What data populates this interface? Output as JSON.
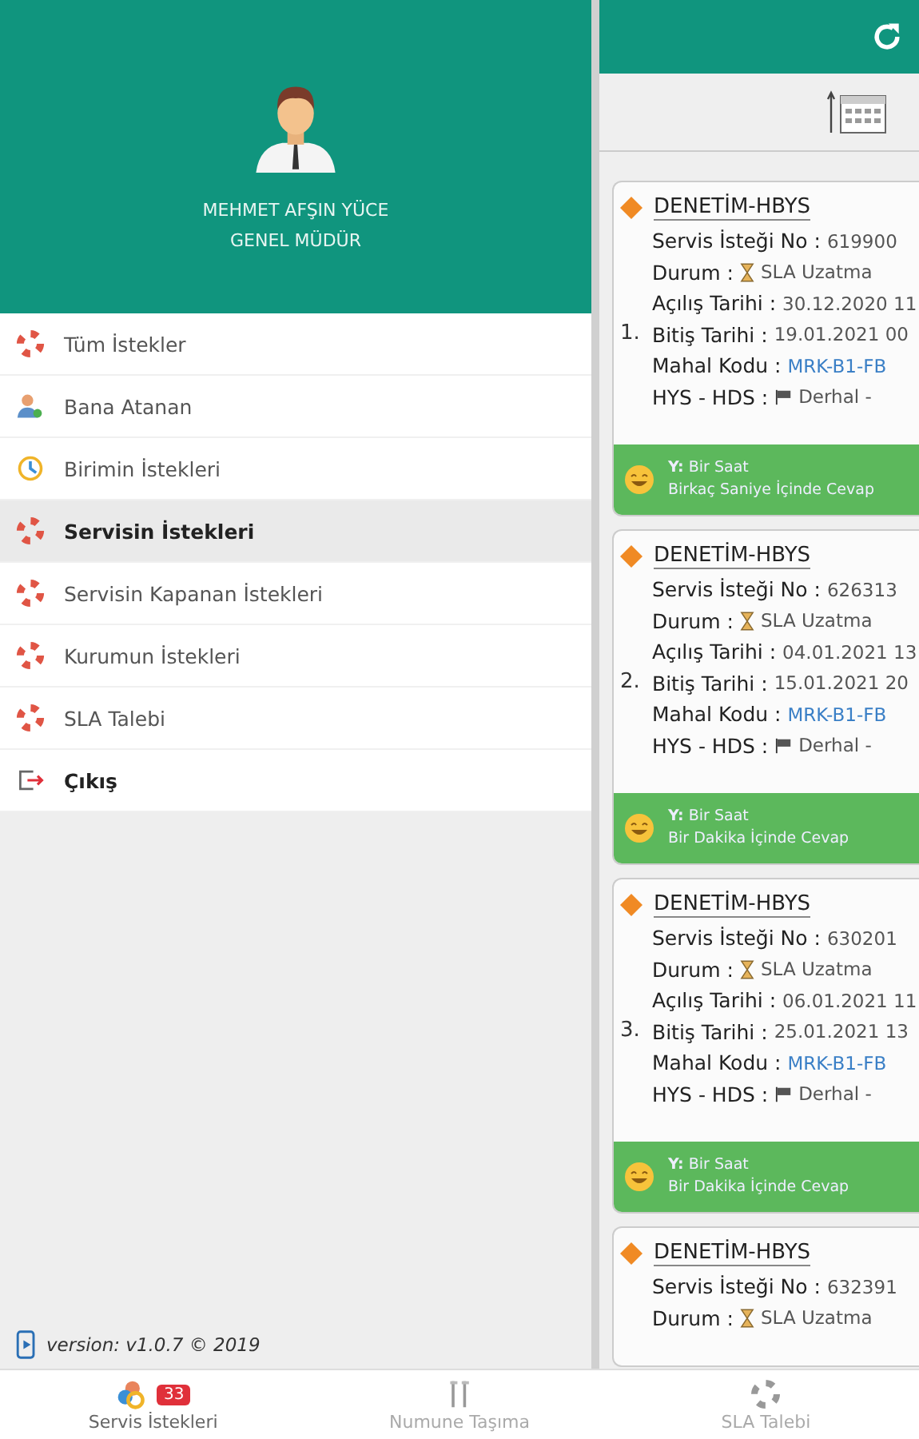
{
  "user": {
    "name": "MEHMET AFŞIN YÜCE",
    "title": "GENEL MÜDÜR"
  },
  "menu": [
    {
      "label": "Tüm İstekler",
      "kind": "lifebuoy",
      "selected": false
    },
    {
      "label": "Bana Atanan",
      "kind": "person",
      "selected": false
    },
    {
      "label": "Birimin İstekleri",
      "kind": "clock",
      "selected": false
    },
    {
      "label": "Servisin İstekleri",
      "kind": "lifebuoy",
      "selected": true
    },
    {
      "label": "Servisin Kapanan İstekleri",
      "kind": "lifebuoy",
      "selected": false
    },
    {
      "label": "Kurumun İstekleri",
      "kind": "lifebuoy",
      "selected": false
    },
    {
      "label": "SLA Talebi",
      "kind": "lifebuoy",
      "selected": false
    },
    {
      "label": "Çıkış",
      "kind": "logout",
      "selected": false
    }
  ],
  "version": "version: v1.0.7 © 2019",
  "cards": [
    {
      "index": "1.",
      "title": "DENETİM-HBYS",
      "rows": [
        {
          "label": "Servis İsteği No :",
          "value": "619900",
          "kind": "text"
        },
        {
          "label": "Durum :",
          "value": "SLA Uzatma",
          "kind": "status"
        },
        {
          "label": "Açılış Tarihi :",
          "value": "30.12.2020 11",
          "kind": "text"
        },
        {
          "label": "Bitiş Tarihi :",
          "value": "19.01.2021 00",
          "kind": "text"
        },
        {
          "label": "Mahal Kodu :",
          "value": "MRK-B1-FB",
          "kind": "link"
        },
        {
          "label": "HYS - HDS :",
          "value": "Derhal -",
          "kind": "flag"
        }
      ],
      "sla": [
        "**Y:** Bir Saat",
        "Birkaç Saniye İçinde Cevap"
      ]
    },
    {
      "index": "2.",
      "title": "DENETİM-HBYS",
      "rows": [
        {
          "label": "Servis İsteği No :",
          "value": "626313",
          "kind": "text"
        },
        {
          "label": "Durum :",
          "value": "SLA Uzatma",
          "kind": "status"
        },
        {
          "label": "Açılış Tarihi :",
          "value": "04.01.2021 13",
          "kind": "text"
        },
        {
          "label": "Bitiş Tarihi :",
          "value": "15.01.2021 20",
          "kind": "text"
        },
        {
          "label": "Mahal Kodu :",
          "value": "MRK-B1-FB",
          "kind": "link"
        },
        {
          "label": "HYS - HDS :",
          "value": "Derhal -",
          "kind": "flag"
        }
      ],
      "sla": [
        "**Y:** Bir Saat",
        "Bir Dakika İçinde Cevap"
      ]
    },
    {
      "index": "3.",
      "title": "DENETİM-HBYS",
      "rows": [
        {
          "label": "Servis İsteği No :",
          "value": "630201",
          "kind": "text"
        },
        {
          "label": "Durum :",
          "value": "SLA Uzatma",
          "kind": "status"
        },
        {
          "label": "Açılış Tarihi :",
          "value": "06.01.2021 11",
          "kind": "text"
        },
        {
          "label": "Bitiş Tarihi :",
          "value": "25.01.2021 13",
          "kind": "text"
        },
        {
          "label": "Mahal Kodu :",
          "value": "MRK-B1-FB",
          "kind": "link"
        },
        {
          "label": "HYS - HDS :",
          "value": "Derhal -",
          "kind": "flag"
        }
      ],
      "sla": [
        "**Y:** Bir Saat",
        "Bir Dakika İçinde Cevap"
      ]
    },
    {
      "title": "DENETİM-HBYS",
      "rows": [
        {
          "label": "Servis İsteği No :",
          "value": "632391",
          "kind": "text"
        },
        {
          "label": "Durum :",
          "value": "SLA Uzatma",
          "kind": "status"
        }
      ]
    }
  ],
  "tabs": [
    {
      "label": "Servis İstekleri",
      "kind": "requests",
      "badge": "33",
      "selected": true
    },
    {
      "label": "Numune Taşıma",
      "kind": "tubes",
      "selected": false
    },
    {
      "label": "SLA Talebi",
      "kind": "lifebuoy",
      "selected": false
    }
  ]
}
